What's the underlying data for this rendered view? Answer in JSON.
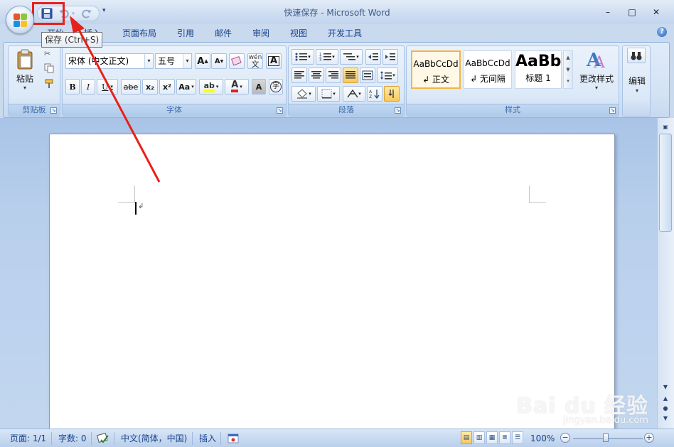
{
  "window": {
    "title": "快速保存 - Microsoft Word",
    "minimize": "–",
    "maximize": "□",
    "close": "✕"
  },
  "tooltip": "保存 (Ctrl+S)",
  "tabs": [
    "开始",
    "插入",
    "页面布局",
    "引用",
    "邮件",
    "审阅",
    "视图",
    "开发工具"
  ],
  "ribbon": {
    "clipboard": {
      "label": "剪贴板",
      "paste": "粘贴"
    },
    "font": {
      "label": "字体",
      "font_name": "宋体 (中文正文)",
      "font_size": "五号",
      "bold": "B",
      "italic": "I",
      "underline": "U",
      "strike": "abe",
      "sub": "x₂",
      "sup": "x²",
      "case": "Aa",
      "color_a": "A",
      "shade_a": "A",
      "enclose": "字",
      "phonetic": "wén"
    },
    "paragraph": {
      "label": "段落"
    },
    "styles": {
      "label": "样式",
      "items": [
        {
          "sample": "AaBbCcDd",
          "name": "↲ 正文"
        },
        {
          "sample": "AaBbCcDd",
          "name": "↲ 无间隔"
        },
        {
          "sample": "AaBb",
          "name": "标题 1"
        }
      ],
      "change_styles": "更改样式"
    },
    "editing": {
      "label": "编辑"
    }
  },
  "document": {
    "paragraph_mark": "↲"
  },
  "status": {
    "page": "页面: 1/1",
    "words": "字数: 0",
    "language": "中文(简体，中国)",
    "mode": "插入",
    "zoom": "100%",
    "zoom_minus": "−",
    "zoom_plus": "+"
  },
  "watermark": {
    "main": "Bai du 经验",
    "sub": "jingyan.baidu.com"
  },
  "colors": {
    "highlight": "#e8201a",
    "accent": "#15428b",
    "font_color": "#e02020",
    "highlight_yellow": "#ffff00"
  }
}
